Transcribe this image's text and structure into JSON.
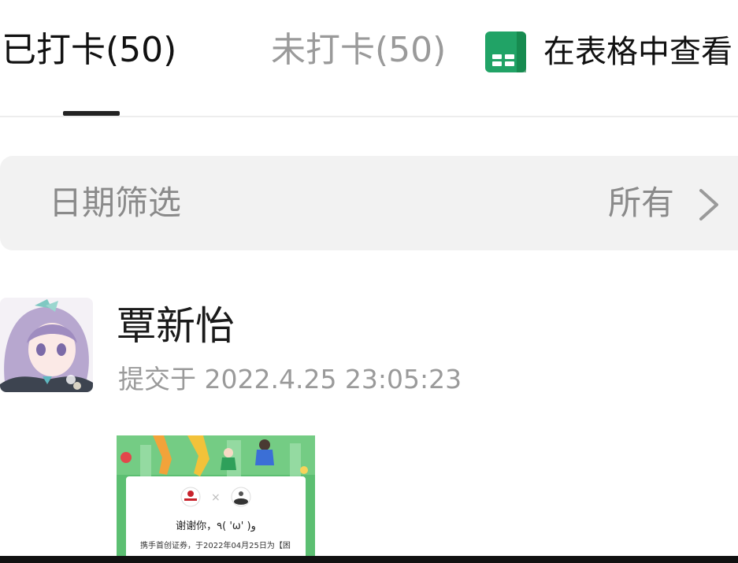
{
  "tabs": {
    "checked_in": "已打卡(50)",
    "not_checked_in": "未打卡(50)",
    "view_in_sheet": "在表格中查看"
  },
  "filter": {
    "label": "日期筛选",
    "value": "所有"
  },
  "submission": {
    "name": "覃新怡",
    "time": "提交于 2022.4.25 23:05:23",
    "attachment": {
      "thanks": "谢谢你，٩( 'ω' )و",
      "body": "携手首创证券，于2022年04月25日为【困"
    }
  },
  "colors": {
    "sheet_icon": "#21a366",
    "attachment_frame": "#5cbf72",
    "filter_background": "#f2f2f2",
    "muted_text": "#9a9a9a"
  }
}
